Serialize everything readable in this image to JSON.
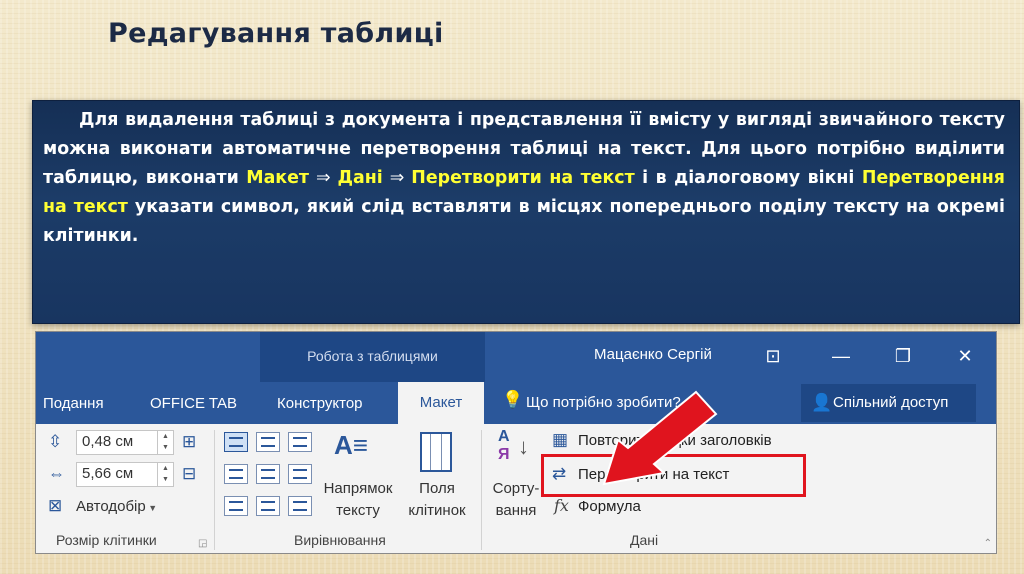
{
  "slide": {
    "title": "Редагування таблиці",
    "paragraph": {
      "part1": "Для видалення таблиці з документа і представлення її вмісту у вигляді звичайного тексту можна виконати автоматичне перетворення таблиці на текст. Для цього потрібно виділити таблицю, виконати ",
      "hl_layout": "Макет",
      "arrow1": " ⇒ ",
      "hl_data": "Дані",
      "arrow2": " ⇒ ",
      "hl_convert": "Перетворити на текст",
      "part2": " і в діалоговому вікні ",
      "hl_dialog": "Перетворення на текст",
      "part3": " указати символ, який слід вставляти в місцях попереднього поділу тексту на окремі клітинки."
    }
  },
  "ribbon": {
    "context_label": "Робота з таблицями",
    "user_name": "Мацаєнко Сергій",
    "window_buttons": {
      "restore_ribbon": "⊡",
      "minimize": "—",
      "maximize": "❐",
      "close": "✕"
    },
    "tabs": [
      "Подання",
      "OFFICE TAB",
      "Конструктор"
    ],
    "active_tab": "Макет",
    "tell_me": "Що потрібно зробити?",
    "share": "Спільний доступ",
    "cell_size": {
      "height_value": "0,48 см",
      "width_value": "5,66 см",
      "autofit": "Автодобір",
      "group_label": "Розмір клітинки"
    },
    "alignment": {
      "text_direction": [
        "Напрямок",
        "тексту"
      ],
      "cell_margins": [
        "Поля",
        "клітинок"
      ],
      "group_label": "Вирівнювання"
    },
    "data": {
      "sort": [
        "Сорту-",
        "вання"
      ],
      "repeat_header": "Повторити рядки заголовків",
      "convert_to_text": "Перетворити на текст",
      "formula": "Формула",
      "group_label": "Дані"
    }
  },
  "colors": {
    "ribbon_blue": "#2b579a",
    "slide_panel": "#1c3c68",
    "highlight": "#ffff33",
    "callout_red": "#e0141e"
  },
  "icons": [
    "arrow-right-icon",
    "restore-icon",
    "minimize-icon",
    "maximize-icon",
    "close-icon",
    "lightbulb-icon",
    "person-add-icon",
    "sort-az-icon",
    "fx-icon",
    "convert-table-icon",
    "red-pointer-arrow-icon"
  ]
}
